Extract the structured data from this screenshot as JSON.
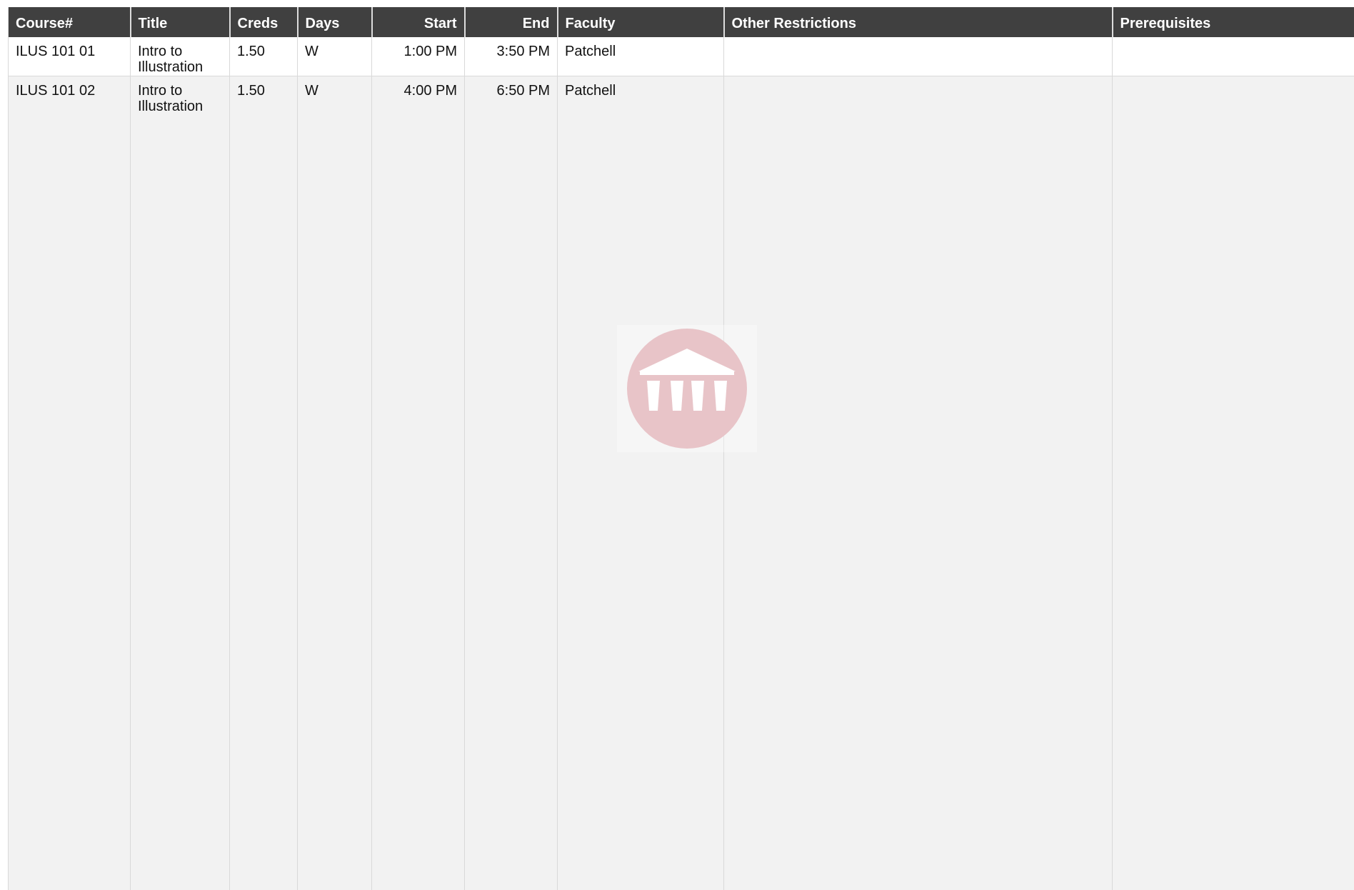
{
  "table": {
    "headers": {
      "course": "Course#",
      "title": "Title",
      "creds": "Creds",
      "days": "Days",
      "start": "Start",
      "end": "End",
      "faculty": "Faculty",
      "other_restrictions": "Other Restrictions",
      "prerequisites": "Prerequisites"
    },
    "rows": [
      {
        "course": "ILUS 101 01",
        "title": "Intro to Illustration",
        "creds": "1.50",
        "days": "W",
        "start": "1:00 PM",
        "end": "3:50 PM",
        "faculty": "Patchell",
        "other_restrictions": "",
        "prerequisites": ""
      },
      {
        "course": "ILUS 101 02",
        "title": "Intro to Illustration",
        "creds": "1.50",
        "days": "W",
        "start": "4:00 PM",
        "end": "6:50 PM",
        "faculty": "Patchell",
        "other_restrictions": "",
        "prerequisites": ""
      }
    ]
  },
  "watermark": {
    "icon": "institution-building-icon",
    "color": "#e8c4c8"
  },
  "colors": {
    "header_bg": "#404040",
    "header_text": "#ffffff",
    "row_alt_bg": "#f2f2f2",
    "grid_line": "#d9d9d9"
  }
}
